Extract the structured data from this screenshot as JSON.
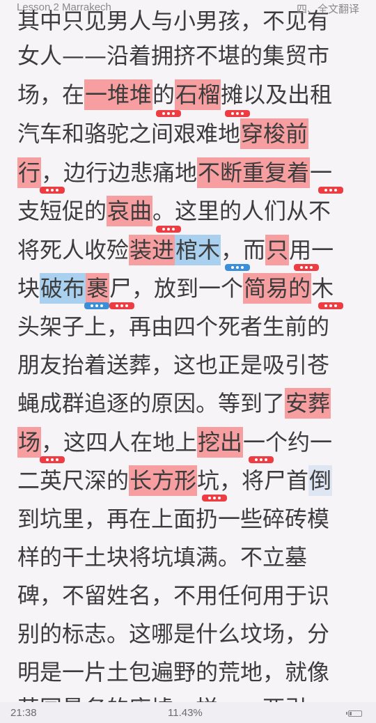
{
  "header": {
    "lesson_title": "Lesson 2    Marrakech",
    "section_title": "四、全文翻译"
  },
  "text": {
    "l0": "其中只见男人与小男孩，不见有",
    "l1": "女人——沿着拥挤不堪的集贸市",
    "l2_a": "场，在",
    "l2_b": "一堆堆",
    "l2_c": "的",
    "l2_d": "石榴",
    "l2_e": "摊以及出租",
    "l3_a": "汽车和骆驼之间艰难地",
    "l3_b": "穿梭前",
    "l4_a": "行",
    "l4_b": "，边行边悲痛地",
    "l4_c": "不断重复着",
    "l4_d": "一",
    "l5_a": "支短促的",
    "l5_b": "哀曲",
    "l5_c": "。这里的人们从不",
    "l6_a": "将死人收殓",
    "l6_b": "装进",
    "l6_c": "棺木",
    "l6_d": "，而",
    "l6_e": "只",
    "l6_f": "用一",
    "l7_a": "块",
    "l7_b": "破布",
    "l7_c": "裹",
    "l7_d": "尸，放到一个",
    "l7_e": "简易的",
    "l7_f": "木",
    "l8": "头架子上，再由四个死者生前的",
    "l9": "朋友抬着送葬，这也正是吸引苍",
    "l10_a": "蝇成群追逐的原因。等到了",
    "l10_b": "安葬",
    "l11_a": "场",
    "l11_b": "，这四人在地上",
    "l11_c": "挖出",
    "l11_d": "一个约一",
    "l12_a": "二英尺深的",
    "l12_b": "长方形",
    "l12_c": "坑，将尸首",
    "l12_d": "倒",
    "l13": "到坑里，再在上面扔一些碎砖模",
    "l14": "样的干土块将坑填满。不立墓",
    "l15": "碑，不留姓名，不用任何用于识",
    "l16": "别的标志。这哪是什么坟场，分",
    "l17": "明是一片土包遍野的荒地，就像",
    "l18": "英国垦务的废墟一样。一两引"
  },
  "status": {
    "time": "21:38",
    "progress": "11.43%"
  },
  "colors": {
    "highlight_red": "#f79ea1",
    "highlight_blue": "#a9d1ef",
    "note_badge_red": "#ee3c43",
    "note_badge_blue": "#3a8fd8"
  },
  "icons": {
    "note_badge": "ellipsis-badge-icon",
    "battery": "battery-icon"
  }
}
